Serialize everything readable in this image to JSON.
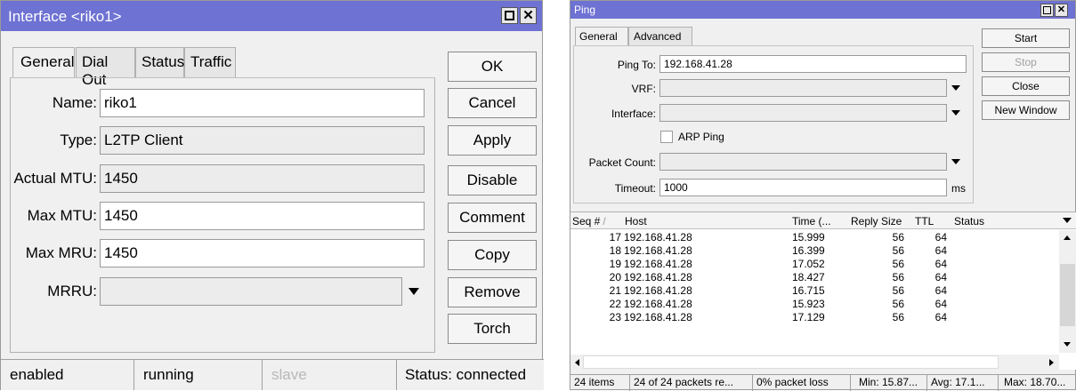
{
  "interface_window": {
    "title": "Interface <riko1>",
    "tabs": [
      "General",
      "Dial Out",
      "Status",
      "Traffic"
    ],
    "fields": {
      "name_label": "Name:",
      "name_value": "riko1",
      "type_label": "Type:",
      "type_value": "L2TP Client",
      "actual_mtu_label": "Actual MTU:",
      "actual_mtu_value": "1450",
      "max_mtu_label": "Max MTU:",
      "max_mtu_value": "1450",
      "max_mru_label": "Max MRU:",
      "max_mru_value": "1450",
      "mrru_label": "MRRU:",
      "mrru_value": ""
    },
    "buttons": [
      "OK",
      "Cancel",
      "Apply",
      "Disable",
      "Comment",
      "Copy",
      "Remove",
      "Torch"
    ],
    "status_bar": [
      "enabled",
      "running",
      "slave",
      "Status: connected"
    ]
  },
  "ping_window": {
    "title": "Ping",
    "tabs": [
      "General",
      "Advanced"
    ],
    "fields": {
      "ping_to_label": "Ping To:",
      "ping_to_value": "192.168.41.28",
      "vrf_label": "VRF:",
      "vrf_value": "",
      "interface_label": "Interface:",
      "interface_value": "",
      "arp_ping_label": "ARP Ping",
      "packet_count_label": "Packet Count:",
      "packet_count_value": "",
      "timeout_label": "Timeout:",
      "timeout_value": "1000",
      "timeout_unit": "ms"
    },
    "buttons": [
      "Start",
      "Stop",
      "Close",
      "New Window"
    ],
    "columns": [
      "Seq #",
      "Host",
      "Time (...",
      "Reply Size",
      "TTL",
      "Status"
    ],
    "rows": [
      {
        "seq": "17",
        "host": "192.168.41.28",
        "time": "15.999",
        "size": "56",
        "ttl": "64",
        "status": ""
      },
      {
        "seq": "18",
        "host": "192.168.41.28",
        "time": "16.399",
        "size": "56",
        "ttl": "64",
        "status": ""
      },
      {
        "seq": "19",
        "host": "192.168.41.28",
        "time": "17.052",
        "size": "56",
        "ttl": "64",
        "status": ""
      },
      {
        "seq": "20",
        "host": "192.168.41.28",
        "time": "18.427",
        "size": "56",
        "ttl": "64",
        "status": ""
      },
      {
        "seq": "21",
        "host": "192.168.41.28",
        "time": "16.715",
        "size": "56",
        "ttl": "64",
        "status": ""
      },
      {
        "seq": "22",
        "host": "192.168.41.28",
        "time": "15.923",
        "size": "56",
        "ttl": "64",
        "status": ""
      },
      {
        "seq": "23",
        "host": "192.168.41.28",
        "time": "17.129",
        "size": "56",
        "ttl": "64",
        "status": ""
      }
    ],
    "status_bar": [
      "24 items",
      "24 of 24 packets re...",
      "0% packet loss",
      "Min: 15.87...",
      "Avg: 17.1...",
      "Max: 18.70..."
    ]
  },
  "icons": {
    "maximize": "maximize-icon",
    "close": "close-icon",
    "dropdown": "chevron-down-icon",
    "sort": "sort-icon"
  },
  "colors": {
    "titlebar": "#6e72d2",
    "window_bg": "#f0f0f0"
  }
}
